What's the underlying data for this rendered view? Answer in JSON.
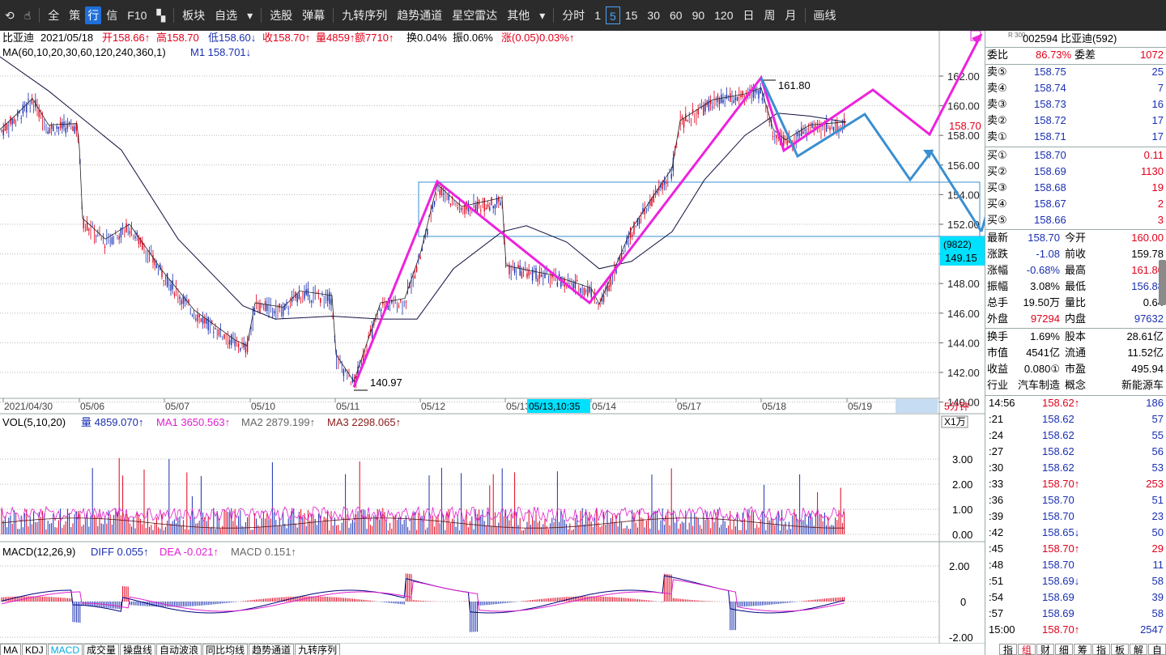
{
  "toolbar": {
    "items": [
      "全",
      "策",
      "行",
      "信",
      "F10",
      "板块",
      "自选",
      "选股",
      "弹幕",
      "九转序列",
      "趋势通道",
      "星空雷达",
      "其他",
      "分时",
      "1",
      "5",
      "15",
      "30",
      "60",
      "90",
      "120",
      "日",
      "周",
      "月",
      "画线"
    ],
    "active_period": "5"
  },
  "header": {
    "name": "比亚迪",
    "date": "2021/05/18",
    "open": "开158.66↑",
    "high": "高158.70",
    "low": "低158.60↓",
    "close": "收158.70↑",
    "vol": "量4859↑",
    "amount": "额7710↑",
    "turnover": "换0.04%",
    "amplitude": "振0.06%",
    "change": "涨(0.05)0.03%↑"
  },
  "ma_line": {
    "label": "MA(60,10,20,30,60,120,240,360,1)",
    "m1": "M1 158.701↓"
  },
  "price_axis": [
    "162.00",
    "160.00",
    "158.00",
    "156.00",
    "154.00",
    "152.00",
    "150.00",
    "148.00",
    "146.00",
    "144.00",
    "142.00",
    "140.00"
  ],
  "date_axis": [
    "2021/04/30",
    "05/06",
    "05/07",
    "05/10",
    "05/11",
    "05/12",
    "05/13",
    "05/14",
    "05/17",
    "05/18",
    "05/19"
  ],
  "crosshair_date": "05/13,10:35",
  "crosshair_tag_top": "(9822)",
  "crosshair_tag_price": "149.15",
  "current_price_tag": "158.70",
  "period_label": "5分钟",
  "annotations": {
    "high": "161.80",
    "low": "140.97"
  },
  "vol": {
    "label": "VOL(5,10,20)",
    "vol": "量 4859.070↑",
    "ma1": "MA1 3650.563↑",
    "ma2": "MA2 2879.199↑",
    "ma3": "MA3 2298.065↑",
    "unit": "X1万",
    "axis": [
      "3.00",
      "2.00",
      "1.00",
      "0.00"
    ]
  },
  "macd": {
    "label": "MACD(12,26,9)",
    "diff": "DIFF 0.055↑",
    "dea": "DEA -0.021↑",
    "macd": "MACD 0.151↑",
    "axis": [
      "2.00",
      "0",
      "-2.00"
    ]
  },
  "bottom_tabs": [
    "MA",
    "KDJ",
    "MACD",
    "成交量",
    "操盘线",
    "自动波浪",
    "同比均线",
    "趋势通道",
    "九转序列"
  ],
  "panel": {
    "code_line": "002594 比亚迪(592)",
    "r_label": "R 300",
    "weibi_label": "委比",
    "weibi": "86.73%",
    "weicha_label": "委差",
    "weicha": "1072",
    "sells": [
      {
        "label": "卖⑤",
        "price": "158.75",
        "vol": "25"
      },
      {
        "label": "卖④",
        "price": "158.74",
        "vol": "7"
      },
      {
        "label": "卖③",
        "price": "158.73",
        "vol": "16"
      },
      {
        "label": "卖②",
        "price": "158.72",
        "vol": "17"
      },
      {
        "label": "卖①",
        "price": "158.71",
        "vol": "17"
      }
    ],
    "buys": [
      {
        "label": "买①",
        "price": "158.70",
        "vol": "0.11"
      },
      {
        "label": "买②",
        "price": "158.69",
        "vol": "1130"
      },
      {
        "label": "买③",
        "price": "158.68",
        "vol": "19"
      },
      {
        "label": "买④",
        "price": "158.67",
        "vol": "2"
      },
      {
        "label": "买⑤",
        "price": "158.66",
        "vol": "3"
      }
    ],
    "stats": [
      {
        "l1": "最新",
        "v1": "158.70",
        "l2": "今开",
        "v2": "160.00"
      },
      {
        "l1": "涨跌",
        "v1": "-1.08",
        "l2": "前收",
        "v2": "159.78"
      },
      {
        "l1": "涨幅",
        "v1": "-0.68%",
        "l2": "最高",
        "v2": "161.80"
      },
      {
        "l1": "振幅",
        "v1": "3.08%",
        "l2": "最低",
        "v2": "156.88"
      },
      {
        "l1": "总手",
        "v1": "19.50万",
        "l2": "量比",
        "v2": "0.64"
      },
      {
        "l1": "外盘",
        "v1": "97294",
        "l2": "内盘",
        "v2": "97632"
      }
    ],
    "stats2": [
      {
        "l1": "换手",
        "v1": "1.69%",
        "l2": "股本",
        "v2": "28.61亿"
      },
      {
        "l1": "市值",
        "v1": "4541亿",
        "l2": "流通",
        "v2": "11.52亿"
      },
      {
        "l1": "收益",
        "v1": "0.080①",
        "l2": "市盈",
        "v2": "495.94"
      },
      {
        "l1": "行业",
        "v1": "汽车制造",
        "l2": "概念",
        "v2": "新能源车"
      }
    ],
    "ticks": [
      {
        "t": "14:56",
        "p": "158.62↑",
        "v": "186"
      },
      {
        "t": ":21",
        "p": "158.62",
        "v": "57"
      },
      {
        "t": ":24",
        "p": "158.62",
        "v": "55"
      },
      {
        "t": ":27",
        "p": "158.62",
        "v": "56"
      },
      {
        "t": ":30",
        "p": "158.62",
        "v": "53"
      },
      {
        "t": ":33",
        "p": "158.70↑",
        "v": "253"
      },
      {
        "t": ":36",
        "p": "158.70",
        "v": "51"
      },
      {
        "t": ":39",
        "p": "158.70",
        "v": "23"
      },
      {
        "t": ":42",
        "p": "158.65↓",
        "v": "50"
      },
      {
        "t": ":45",
        "p": "158.70↑",
        "v": "29"
      },
      {
        "t": ":48",
        "p": "158.70",
        "v": "11"
      },
      {
        "t": ":51",
        "p": "158.69↓",
        "v": "58"
      },
      {
        "t": ":54",
        "p": "158.69",
        "v": "39"
      },
      {
        "t": ":57",
        "p": "158.69",
        "v": "58"
      },
      {
        "t": "15:00",
        "p": "158.70↑",
        "v": "2547"
      }
    ],
    "tabs": [
      "指",
      "组",
      "财",
      "细",
      "筹",
      "指",
      "板",
      "解",
      "自"
    ]
  }
}
